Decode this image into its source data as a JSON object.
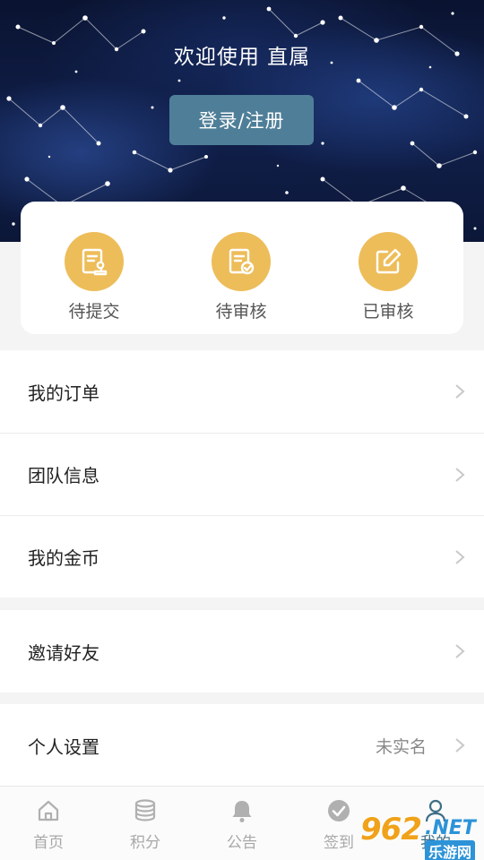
{
  "header": {
    "welcome": "欢迎使用 直属",
    "login_button": "登录/注册"
  },
  "status": [
    {
      "label": "待提交",
      "icon": "document-stamp-icon"
    },
    {
      "label": "待审核",
      "icon": "document-check-icon"
    },
    {
      "label": "已审核",
      "icon": "edit-icon"
    }
  ],
  "menu": {
    "orders": "我的订单",
    "team": "团队信息",
    "coins": "我的金币",
    "invite": "邀请好友",
    "settings": "个人设置",
    "settings_value": "未实名"
  },
  "tabs": [
    {
      "label": "首页",
      "icon": "home-icon"
    },
    {
      "label": "积分",
      "icon": "coins-stack-icon"
    },
    {
      "label": "公告",
      "icon": "bell-icon"
    },
    {
      "label": "签到",
      "icon": "check-circle-icon"
    },
    {
      "label": "我的",
      "icon": "user-icon"
    }
  ],
  "watermark": {
    "number": "962",
    "domain": ".NET",
    "site": "乐游网"
  },
  "colors": {
    "accent": "#4f7f98",
    "status_icon": "#edbd5a",
    "tab_inactive": "#a8a8a8"
  }
}
